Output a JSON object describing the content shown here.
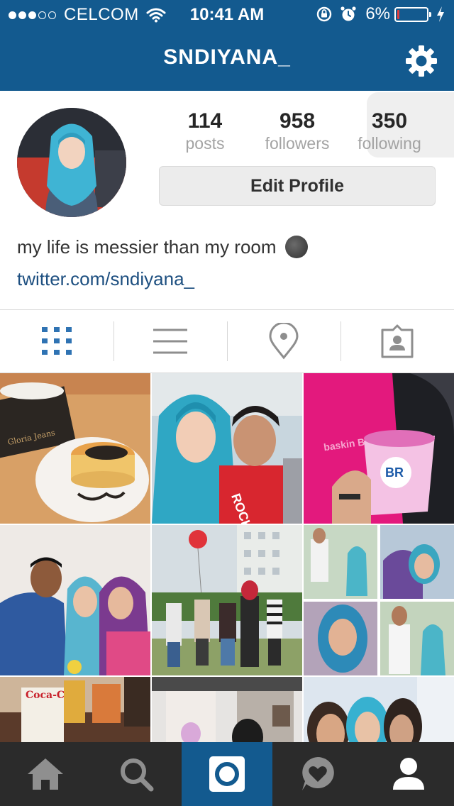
{
  "status_bar": {
    "carrier": "CELCOM",
    "time": "10:41 AM",
    "battery": "6%",
    "battery_level": 0.06,
    "signal_bars": 3
  },
  "nav": {
    "title": "SNDIYANA_",
    "settings_icon": "gear-icon"
  },
  "profile": {
    "stats": [
      {
        "value": "114",
        "label": "posts"
      },
      {
        "value": "958",
        "label": "followers"
      },
      {
        "value": "350",
        "label": "following"
      }
    ],
    "edit_button": "Edit Profile",
    "bio": "my life is messier than my room",
    "bio_emoji": "new-moon-face-icon",
    "link": "twitter.com/sndiyana_"
  },
  "view_tabs": [
    {
      "icon": "grid-icon",
      "active": true
    },
    {
      "icon": "list-icon",
      "active": false
    },
    {
      "icon": "location-pin-icon",
      "active": false
    },
    {
      "icon": "tagged-user-icon",
      "active": false
    }
  ],
  "bottom_tabs": [
    {
      "icon": "home-icon",
      "active": false
    },
    {
      "icon": "search-icon",
      "active": false
    },
    {
      "icon": "camera-icon",
      "active": true
    },
    {
      "icon": "activity-heart-icon",
      "active": false
    },
    {
      "icon": "profile-icon",
      "active": false
    }
  ],
  "colors": {
    "header": "#135a8f",
    "link": "#1d4f80",
    "tab_active": "#2f73b3",
    "tab_inactive": "#8e8e8e",
    "tabbar_bg": "#2b2b2b"
  }
}
